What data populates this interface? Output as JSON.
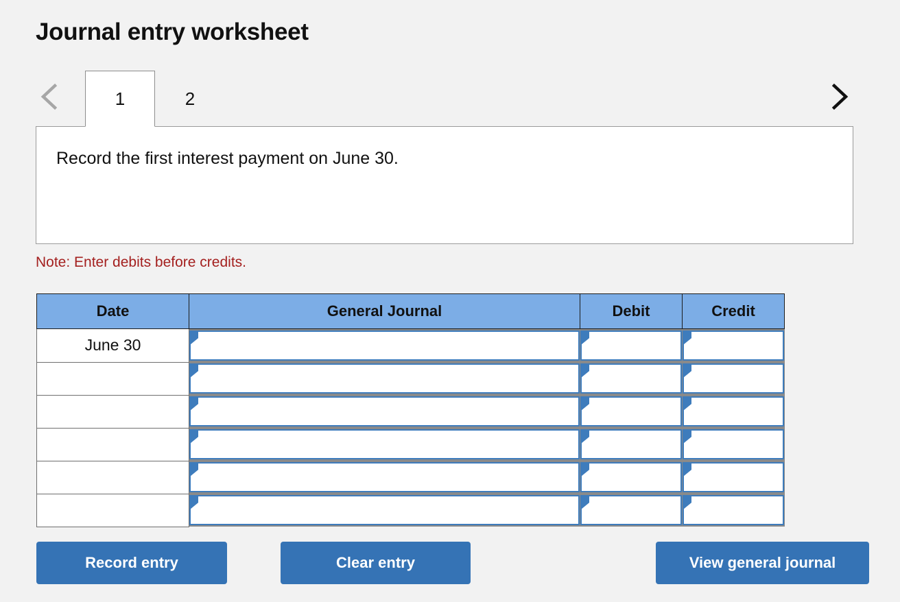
{
  "page": {
    "title": "Journal entry worksheet",
    "background_color": "#f2f2f2"
  },
  "tabs": {
    "prev_icon": "chevron-left-icon",
    "next_icon": "chevron-right-icon",
    "prev_enabled": false,
    "next_enabled": true,
    "items": [
      {
        "label": "1",
        "active": true
      },
      {
        "label": "2",
        "active": false
      }
    ]
  },
  "prompt": {
    "text": "Record the first interest payment on June 30."
  },
  "note": {
    "text": "Note: Enter debits before credits.",
    "color": "#a4201f"
  },
  "journal": {
    "header_color": "#7cade6",
    "input_border_color": "#3e7cbc",
    "columns": [
      "Date",
      "General Journal",
      "Debit",
      "Credit"
    ],
    "rows": [
      {
        "date": "June 30",
        "general_journal": "",
        "debit": "",
        "credit": ""
      },
      {
        "date": "",
        "general_journal": "",
        "debit": "",
        "credit": ""
      },
      {
        "date": "",
        "general_journal": "",
        "debit": "",
        "credit": ""
      },
      {
        "date": "",
        "general_journal": "",
        "debit": "",
        "credit": ""
      },
      {
        "date": "",
        "general_journal": "",
        "debit": "",
        "credit": ""
      },
      {
        "date": "",
        "general_journal": "",
        "debit": "",
        "credit": ""
      }
    ]
  },
  "actions": {
    "record_label": "Record entry",
    "clear_label": "Clear entry",
    "view_label": "View general journal",
    "button_color": "#3573b5"
  }
}
